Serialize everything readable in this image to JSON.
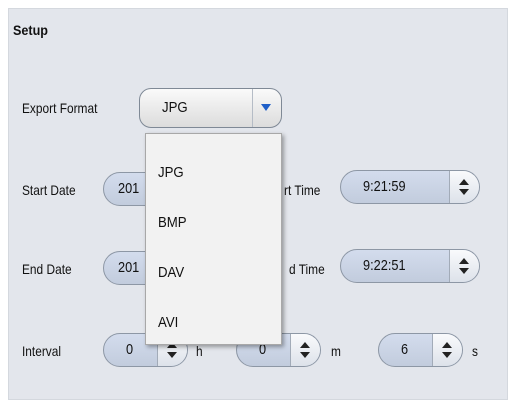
{
  "setup": {
    "title": "Setup",
    "export_format": {
      "label": "Export Format",
      "selected": "JPG",
      "options": [
        "JPG",
        "BMP",
        "DAV",
        "AVI"
      ]
    },
    "start_date": {
      "label": "Start Date",
      "value_visible": "201"
    },
    "start_time": {
      "label_visible": "rt Time",
      "value": "9:21:59"
    },
    "end_date": {
      "label": "End Date",
      "value_visible": "201"
    },
    "end_time": {
      "label_visible": "d Time",
      "value": "9:22:51"
    },
    "interval": {
      "label": "Interval",
      "hours": {
        "value": "0",
        "unit_visible": "h"
      },
      "minutes": {
        "value": "0",
        "unit": "m"
      },
      "seconds": {
        "value": "6",
        "unit": "s"
      }
    }
  },
  "icons": {
    "dropdown_arrow": "chevron-down-icon",
    "spinner": "up-down-spinner-icon"
  },
  "colors": {
    "panel": "#e3e6ec",
    "field": "#c9d2e2",
    "dropdown_arrow": "#1f5fc8"
  }
}
